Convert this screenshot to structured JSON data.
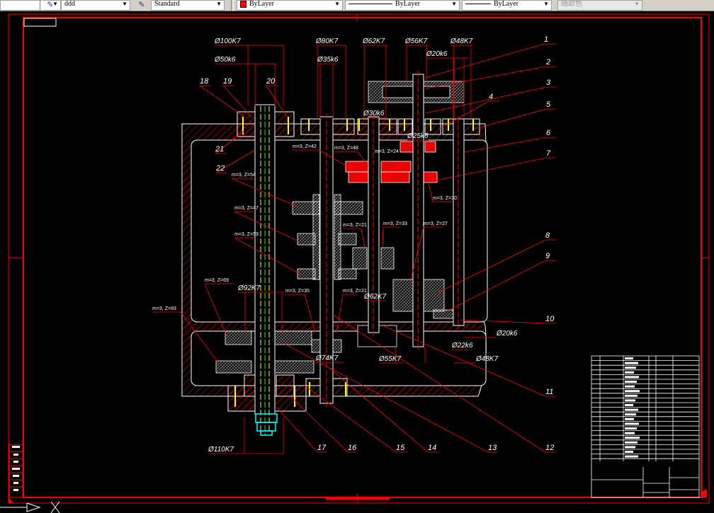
{
  "toolbar": {
    "layer": "ddd",
    "text_style": "Standard",
    "color": "ByLayer",
    "color_swatch": "#ff0000",
    "linetype": "ByLayer",
    "lineweight": "ByLayer",
    "plot_style": "随颜色"
  },
  "drawing": {
    "dimensions": [
      "Ø100K7",
      "Ø50k6",
      "Ø80K7",
      "Ø35k6",
      "Ø62K7",
      "Ø56K7",
      "Ø48K7",
      "Ø20k6",
      "Ø30k6",
      "Ø25k6",
      "Ø92K7",
      "Ø62K7",
      "Ø74K7",
      "Ø55K7",
      "Ø20k6",
      "Ø22k6",
      "Ø48K7",
      "Ø110K7"
    ],
    "gear_labels": [
      "m=3, Z=42",
      "m=3, Z=48",
      "m=3, Z=24",
      "m=3, Z=30",
      "m=3, Z=54",
      "m=3, Z=47",
      "m=3, Z=59",
      "m=3, Z=21",
      "m=3, Z=33",
      "m=3, Z=27",
      "m=3, Z=69",
      "m=3, Z=35",
      "m=3, Z=21",
      "m=3, Z=83"
    ],
    "part_numbers": [
      "1",
      "2",
      "3",
      "4",
      "5",
      "6",
      "7",
      "8",
      "9",
      "10",
      "11",
      "12",
      "13",
      "14",
      "15",
      "16",
      "17",
      "18",
      "19",
      "20",
      "21",
      "22"
    ]
  },
  "colors": {
    "frame": "#ff0000",
    "lines": "#ffffff",
    "centerline": "#00ff00",
    "nut": "#00ffff",
    "background": "#000000"
  }
}
